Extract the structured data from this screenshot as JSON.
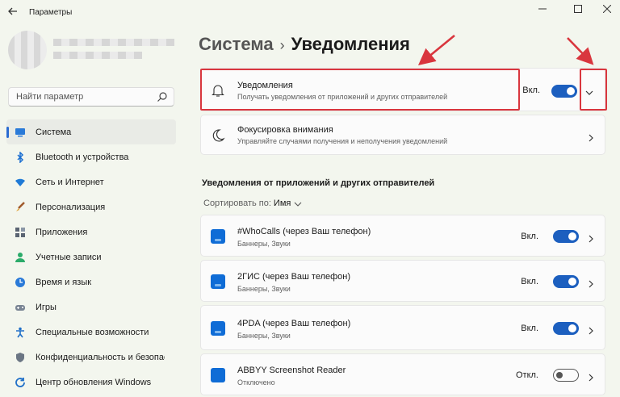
{
  "window": {
    "back_icon": "arrow-left-icon",
    "title": "Параметры",
    "controls": [
      "minimize-icon",
      "maximize-icon",
      "close-icon"
    ]
  },
  "search": {
    "placeholder": "Найти параметр",
    "icon": "search-icon"
  },
  "sidebar": {
    "items": [
      {
        "label": "Система",
        "icon": "monitor-icon",
        "active": true
      },
      {
        "label": "Bluetooth и устройства",
        "icon": "bluetooth-icon"
      },
      {
        "label": "Сеть и Интернет",
        "icon": "wifi-icon"
      },
      {
        "label": "Персонализация",
        "icon": "brush-icon"
      },
      {
        "label": "Приложения",
        "icon": "apps-icon"
      },
      {
        "label": "Учетные записи",
        "icon": "person-icon"
      },
      {
        "label": "Время и язык",
        "icon": "globe-clock-icon"
      },
      {
        "label": "Игры",
        "icon": "gamepad-icon"
      },
      {
        "label": "Специальные возможности",
        "icon": "accessibility-icon"
      },
      {
        "label": "Конфиденциальность и безопас",
        "icon": "shield-icon"
      },
      {
        "label": "Центр обновления Windows",
        "icon": "update-icon"
      }
    ]
  },
  "breadcrumb": {
    "parent": "Система",
    "separator": "›",
    "current": "Уведомления"
  },
  "notifications_card": {
    "title": "Уведомления",
    "subtitle": "Получать уведомления от приложений и других отправителей",
    "state": "Вкл.",
    "on": true,
    "icon": "bell-icon",
    "expand_icon": "chevron-down-icon"
  },
  "focus_card": {
    "title": "Фокусировка внимания",
    "subtitle": "Управляйте случаями получения и неполучения уведомлений",
    "icon": "moon-icon"
  },
  "apps_section": {
    "title": "Уведомления от приложений и других отправителей",
    "sort_label": "Сортировать по:",
    "sort_value": "Имя",
    "apps": [
      {
        "name": "#WhoCalls (через Ваш телефон)",
        "detail": "Баннеры, Звуки",
        "state": "Вкл.",
        "on": true,
        "icon": "phone-app-icon"
      },
      {
        "name": "2ГИС (через Ваш телефон)",
        "detail": "Баннеры, Звуки",
        "state": "Вкл.",
        "on": true,
        "icon": "phone-app-icon"
      },
      {
        "name": "4PDA (через Ваш телефон)",
        "detail": "Баннеры, Звуки",
        "state": "Вкл.",
        "on": true,
        "icon": "phone-app-icon"
      },
      {
        "name": "ABBYY Screenshot Reader",
        "detail": "Отключено",
        "state": "Откл.",
        "on": false,
        "icon": "app-tile-icon"
      }
    ]
  },
  "colors": {
    "accent": "#1c5fbf",
    "annotation": "#d9363e",
    "background": "#f3f6ee"
  }
}
